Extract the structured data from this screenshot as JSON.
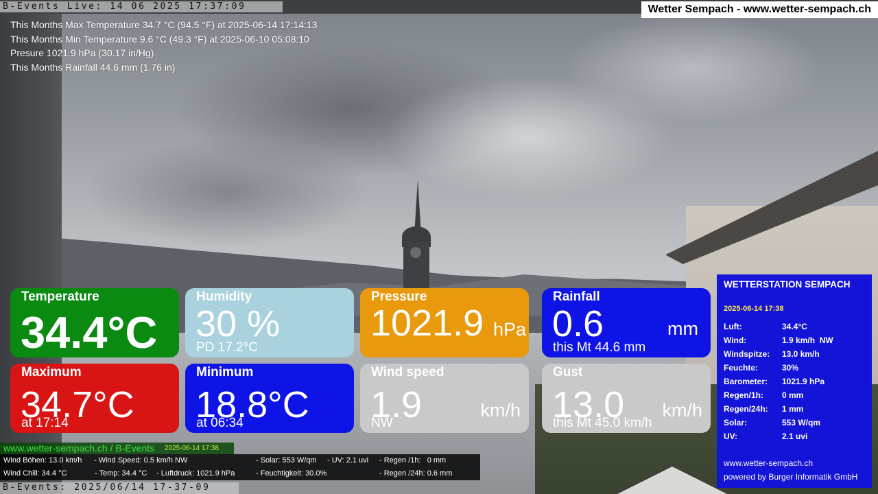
{
  "header": {
    "ticker_top": "B-Events Live: 14 06 2025 17:37:09",
    "site_title": "Wetter Sempach - www.wetter-sempach.ch"
  },
  "month_stats": {
    "max_temp": "This Months Max Temperature 34.7 °C (94.5 °F) at 2025-06-14 17:14:13",
    "min_temp": "This Months Min Temperature 9.6 °C (49.3 °F) at 2025-06-10 05:08:10",
    "pressure": "Presure 1021.9 hPa (30.17 in/Hg)",
    "rainfall": "This Months Rainfall 44.6 mm (1.76 in)"
  },
  "tiles": {
    "temperature": {
      "label": "Temperature",
      "value": "34.4°C",
      "color": "#0b8a12"
    },
    "humidity": {
      "label": "Humidity",
      "value": "30 %",
      "sub": "PD 17.2°C",
      "color": "#a9d2de"
    },
    "pressure": {
      "label": "Pressure",
      "value": "1021.9",
      "unit": "hPa",
      "color": "#e89a0c"
    },
    "rainfall": {
      "label": "Rainfall",
      "value": "0.6",
      "unit": "mm",
      "sub": "this Mt 44.6 mm",
      "color": "#0f14e6"
    },
    "maximum": {
      "label": "Maximum",
      "value": "34.7°C",
      "sub": "at 17:14",
      "color": "#d81414"
    },
    "minimum": {
      "label": "Minimum",
      "value": "18.8°C",
      "sub": "at 06:34",
      "color": "#0f14e6"
    },
    "wind": {
      "label": "Wind speed",
      "value": "1.9",
      "unit": "km/h",
      "sub": "NW",
      "color": "#c9c9c9"
    },
    "gust": {
      "label": "Gust",
      "value": "13.0",
      "unit": "km/h",
      "sub": "this Mt 45.0 km/h",
      "color": "#c9c9c9"
    }
  },
  "station": {
    "title": "WETTERSTATION SEMPACH",
    "date": "2025-06-14 17:38",
    "rows": [
      {
        "k": "Luft:",
        "v": "34.4°C"
      },
      {
        "k": "Wind:",
        "v": "1.9 km/h  NW"
      },
      {
        "k": "Windspitze:",
        "v": "13.0 km/h"
      },
      {
        "k": "Feuchte:",
        "v": "30%"
      },
      {
        "k": "Barometer:",
        "v": "1021.9 hPa"
      },
      {
        "k": "Regen/1h:",
        "v": "0 mm"
      },
      {
        "k": "Regen/24h:",
        "v": "1 mm"
      },
      {
        "k": "Solar:",
        "v": "553 W/qm"
      },
      {
        "k": "UV:",
        "v": "2.1 uvi"
      }
    ],
    "website": "www.wetter-sempach.ch",
    "powered": "powered by Burger Informatik GmbH",
    "color": "#1414d8"
  },
  "bottom": {
    "site": "www.wetter-sempach.ch / B-Events",
    "date": "2025-06-14 17:38",
    "info": {
      "wind_gusts": "Wind Böhen: 13.0 km/h",
      "wind_speed": "- Wind Speed: 0.5 km/h NW",
      "solar": "- Solar: 553 W/qm",
      "uv": "- UV: 2.1 uvi",
      "rain_1h": "- Regen /1h:   0 mm",
      "wind_chill": "Wind Chill: 34.4 °C",
      "temp": "- Temp: 34.4 °C",
      "pressure": "- Luftdruck: 1021.9 hPa",
      "humidity": "- Feuchtigkeit: 30.0%",
      "rain_24h": "- Regen /24h: 0.6 mm"
    },
    "ticker_bottom": "B-Events: 2025/06/14 17-37-09"
  }
}
